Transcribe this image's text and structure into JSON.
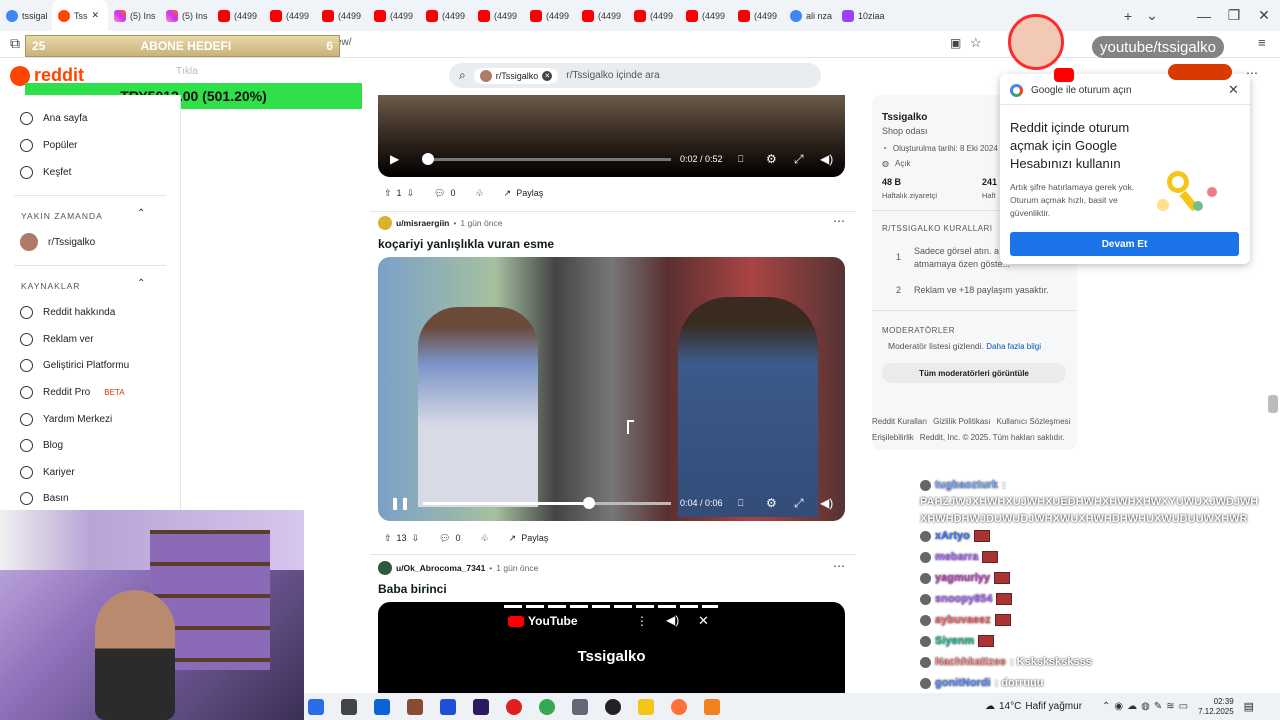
{
  "browser": {
    "tabs": [
      {
        "label": "tssigal",
        "icon": "google-icon"
      },
      {
        "label": "Tss",
        "icon": "reddit-icon",
        "active": true
      },
      {
        "label": "(5) Ins",
        "icon": "instagram-icon"
      },
      {
        "label": "(5) Ins",
        "icon": "instagram-icon"
      },
      {
        "label": "(4499",
        "icon": "youtube-icon"
      },
      {
        "label": "(4499",
        "icon": "youtube-icon"
      },
      {
        "label": "(4499",
        "icon": "youtube-icon"
      },
      {
        "label": "(4499",
        "icon": "youtube-icon"
      },
      {
        "label": "(4499",
        "icon": "youtube-icon"
      },
      {
        "label": "(4499",
        "icon": "youtube-icon"
      },
      {
        "label": "(4499",
        "icon": "youtube-icon"
      },
      {
        "label": "(4499",
        "icon": "youtube-icon"
      },
      {
        "label": "(4499",
        "icon": "youtube-icon"
      },
      {
        "label": "(4499",
        "icon": "youtube-icon"
      },
      {
        "label": "(4499",
        "icon": "youtube-icon"
      },
      {
        "label": "ali nza",
        "icon": "google-icon"
      },
      {
        "label": "10ziaa",
        "icon": "twitch-icon"
      }
    ],
    "url_fragment": "ew/"
  },
  "overlay": {
    "goal_left": "25",
    "goal_title": "ABONE HEDEFI",
    "goal_right": "6",
    "donation": "TRY5012.00 (501.20%)",
    "yt_tag": "youtube/tssigalko",
    "faded_label": "Tıkla"
  },
  "header": {
    "logo": "reddit",
    "search_chip": "r/Tssigalko",
    "search_placeholder": "r/Tssigalko içinde ara"
  },
  "sidebar": {
    "items_top": [
      {
        "label": "Ana sayfa",
        "icon": "home-icon"
      },
      {
        "label": "Popüler",
        "icon": "popular-icon"
      },
      {
        "label": "Keşfet",
        "icon": "explore-icon"
      }
    ],
    "recent_heading": "YAKIN ZAMANDA",
    "recent": [
      {
        "label": "r/Tssigalko"
      }
    ],
    "resources_heading": "KAYNAKLAR",
    "resources": [
      {
        "label": "Reddit hakkında",
        "icon": "reddit-icon"
      },
      {
        "label": "Reklam ver",
        "icon": "megaphone-icon"
      },
      {
        "label": "Geliştirici Platformu",
        "icon": "code-icon"
      },
      {
        "label": "Reddit Pro",
        "icon": "pro-icon",
        "badge": "BETA"
      },
      {
        "label": "Yardım Merkezi",
        "icon": "help-icon"
      },
      {
        "label": "Blog",
        "icon": "blog-icon"
      },
      {
        "label": "Kariyer",
        "icon": "career-icon"
      },
      {
        "label": "Basın",
        "icon": "press-icon"
      }
    ]
  },
  "posts": [
    {
      "time": "0:02 / 0:52",
      "votes": "1",
      "comments": "0",
      "share": "Paylaş",
      "progress": 0.02
    },
    {
      "author": "u/misraergiin",
      "age": "1 gün önce",
      "title": "koçariyi yanlışlıkla vuran esme",
      "time": "0:04 / 0:06",
      "votes": "13",
      "comments": "0",
      "share": "Paylaş",
      "progress": 0.67
    },
    {
      "author": "u/Ok_Abrocoma_7341",
      "age": "1 gün önce",
      "title": "Baba birinci",
      "embed_brand": "YouTube",
      "embed_channel": "Tssigalko"
    }
  ],
  "right_sidebar": {
    "name": "Tssigalko",
    "subtitle": "Shop odası",
    "created": "Oluşturulma tarihi: 8 Eki 2024",
    "visibility": "Açık",
    "stat1_value": "48 B",
    "stat1_label": "Haftalık ziyaretçi",
    "stat2_value": "241",
    "stat2_label": "Haft",
    "rules_heading": "R/TSSIGALKO KURALLARI",
    "rules": [
      {
        "num": "1",
        "text": "Sadece görsel atın. a atmamaya özen göste..."
      },
      {
        "num": "2",
        "text": "Reklam ve +18 paylaşım yasaktır."
      }
    ],
    "mods_heading": "MODERATÖRLER",
    "mods_hidden": "Moderatör listesi gizlendi.",
    "mods_more": "Daha fazla bilgi",
    "mods_button": "Tüm moderatörleri görüntüle",
    "footer_links": [
      "Reddit Kuralları",
      "Gizlilik Politikası",
      "Kullanıcı Sözleşmesi"
    ],
    "footer2": "Erişilebilirlik",
    "copyright": "Reddit, Inc. © 2025. Tüm hakları saklıdır."
  },
  "google_popup": {
    "header": "Google ile oturum açın",
    "title": "Reddit içinde oturum açmak için Google Hesabınızı kullanın",
    "body": "Artık şifre hatırlamaya gerek yok. Oturum açmak hızlı, basit ve güvenliktir.",
    "button": "Devam Et"
  },
  "chat": [
    {
      "user": "tugbaozturk",
      "text": ":",
      "color": "#7aa7ff"
    },
    {
      "user": "",
      "text": "PAHZJWJXHWHXUJWHXUEDHWHXHWHXHWXYUWUXJWDJWH",
      "color": "#ffffff"
    },
    {
      "user": "",
      "text": "XHWHDHWJDUWUDJWHXWUXHWHDHWHUXWUDUUWXHWR",
      "color": "#ffffff"
    },
    {
      "user": "xArtyo",
      "text": "",
      "color": "#3a7bff"
    },
    {
      "user": "mebarra",
      "text": "",
      "color": "#b06bff"
    },
    {
      "user": "yagmurlyy",
      "text": "",
      "color": "#c04ac8"
    },
    {
      "user": "snoopy854",
      "text": "",
      "color": "#b06bff"
    },
    {
      "user": "aybuvaeez",
      "text": "",
      "color": "#ff6b6b"
    },
    {
      "user": "Siyenm",
      "text": "",
      "color": "#23c6a1"
    },
    {
      "user": "Nachhkattzee",
      "text": ": Ksksksksksss",
      "color": "#ff8a8a"
    },
    {
      "user": "gonitNordi",
      "text": ": dorruuu",
      "color": "#5a8cff"
    }
  ],
  "taskbar": {
    "weather_temp": "14°C",
    "weather_text": "Hafif yağmur",
    "time": "02:39",
    "date": "7.12.2025"
  }
}
